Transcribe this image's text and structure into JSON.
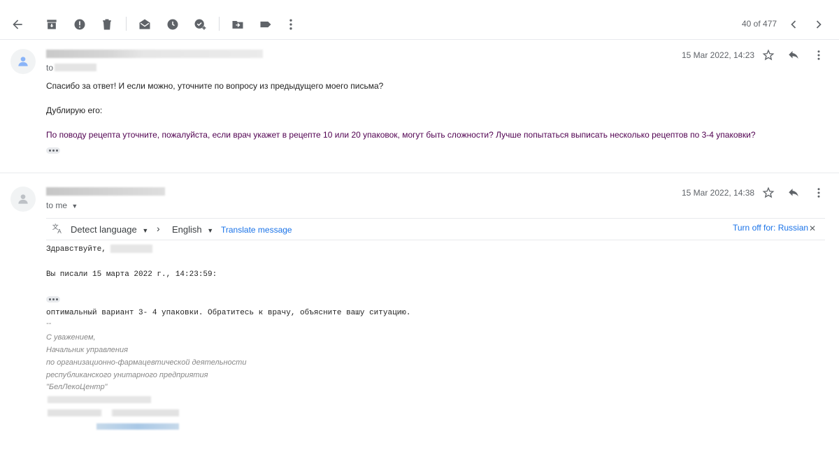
{
  "toolbar": {
    "icons": [
      "back-arrow-icon",
      "archive-icon",
      "report-spam-icon",
      "delete-icon",
      "mark-unread-icon",
      "snooze-icon",
      "add-task-icon",
      "move-to-icon",
      "label-icon",
      "more-vert-icon"
    ],
    "pager": "40 of 477"
  },
  "messages": [
    {
      "date": "15 Mar 2022, 14:23",
      "to_prefix": "to",
      "line1": "Спасибо за ответ! И если можно, уточните по вопросу из предыдущего моего письма?",
      "line2": "Дублирую его:",
      "quote": "По поводу рецепта уточните, пожалуйста, если врач укажет в рецепте 10 или 20 упаковок, могут быть сложности? Лучше попытаться выписать несколько рецептов по 3-4 упаковки?"
    },
    {
      "date": "15 Mar 2022, 14:38",
      "to": "to me",
      "translate": {
        "detect": "Detect language",
        "target": "English",
        "translate_link": "Translate message",
        "turn_off": "Turn off for: Russian"
      },
      "greeting": "Здравствуйте,",
      "wrote": "Вы писали 15 марта 2022 г., 14:23:59:",
      "reply": "оптимальный вариант 3- 4  упаковки. Обратитесь к врачу, объясните вашу ситуацию.",
      "sig_dash": "--",
      "signature": [
        "С уважением,",
        "Начальник управления",
        "по организационно-фармацевтической деятельности",
        "республиканского  унитарного  предприятия",
        "\"БелЛекоЦентр\""
      ]
    }
  ],
  "colors": {
    "accent": "#1a73e8",
    "quote": "#500050",
    "signature": "#888888"
  }
}
